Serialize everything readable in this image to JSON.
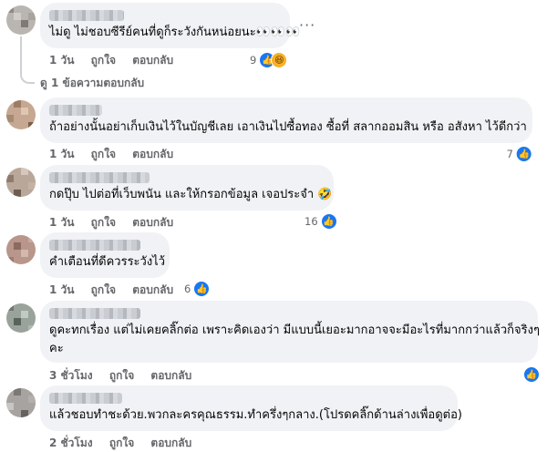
{
  "comments": [
    {
      "text_lines": [
        "ไม่ดู ไม่ชอบซีรีย์คนที่ดูก็ระวังกันหน่อยนะ👀👀👀"
      ],
      "time": "1 วัน",
      "like": "ถูกใจ",
      "reply": "ตอบกลับ",
      "reaction_count": "9",
      "reactions": [
        "like-icon",
        "haha-icon"
      ]
    },
    {
      "text_lines": [
        "ถ้าอย่างนั้นอย่าเก็บเงินไว้ในบัญชีเลย เอาเงินไปซื้อทอง ซื้อที่ สลากออมสิน หรือ อสังหา ไว้ดีกว่า"
      ],
      "time": "1 วัน",
      "like": "ถูกใจ",
      "reply": "ตอบกลับ",
      "reaction_count": "7",
      "reactions": [
        "like-icon"
      ]
    },
    {
      "text_lines": [
        "กดปุ๊บ ไปต่อที่เว็บพนัน และให้กรอกข้อมูล เจอประจำ 🤣"
      ],
      "time": "1 วัน",
      "like": "ถูกใจ",
      "reply": "ตอบกลับ",
      "reaction_count": "16",
      "reactions": [
        "like-icon"
      ]
    },
    {
      "text_lines": [
        "คำเตือนที่ดีควรระวังไว้"
      ],
      "time": "1 วัน",
      "like": "ถูกใจ",
      "reply": "ตอบกลับ",
      "reaction_count": "6",
      "reactions": [
        "like-icon"
      ]
    },
    {
      "text_lines": [
        "ดูคะทกเรื่อง แต่ไม่เคยคลิ๊กต่อ เพราะคิดเองว่า มีแบบนี้เยอะมากอาจจะมีอะไรที่มากกว่าแล้วก็จริงๆ",
        "คะ"
      ],
      "time": "3 ชั่วโมง",
      "like": "ถูกใจ",
      "reply": "ตอบกลับ",
      "reaction_count": "",
      "reactions": [
        "like-icon"
      ]
    },
    {
      "text_lines": [
        "แล้วชอบทำชะด้วย.พวกละครคุณธรรม.ทำครึ่งๆกลาง.(โปรดคลิ๊กด้านล่างเพื่อดูต่อ)"
      ],
      "time": "2 ชั่วโมง",
      "like": "ถูกใจ",
      "reply": "ตอบกลับ",
      "reaction_count": "",
      "reactions": []
    }
  ],
  "view_replies": "ดู 1 ข้อความตอบกลับ",
  "more_menu": "···",
  "colors": {
    "bubble": "#f0f2f5",
    "meta": "#65676b",
    "like": "#1877f2"
  }
}
